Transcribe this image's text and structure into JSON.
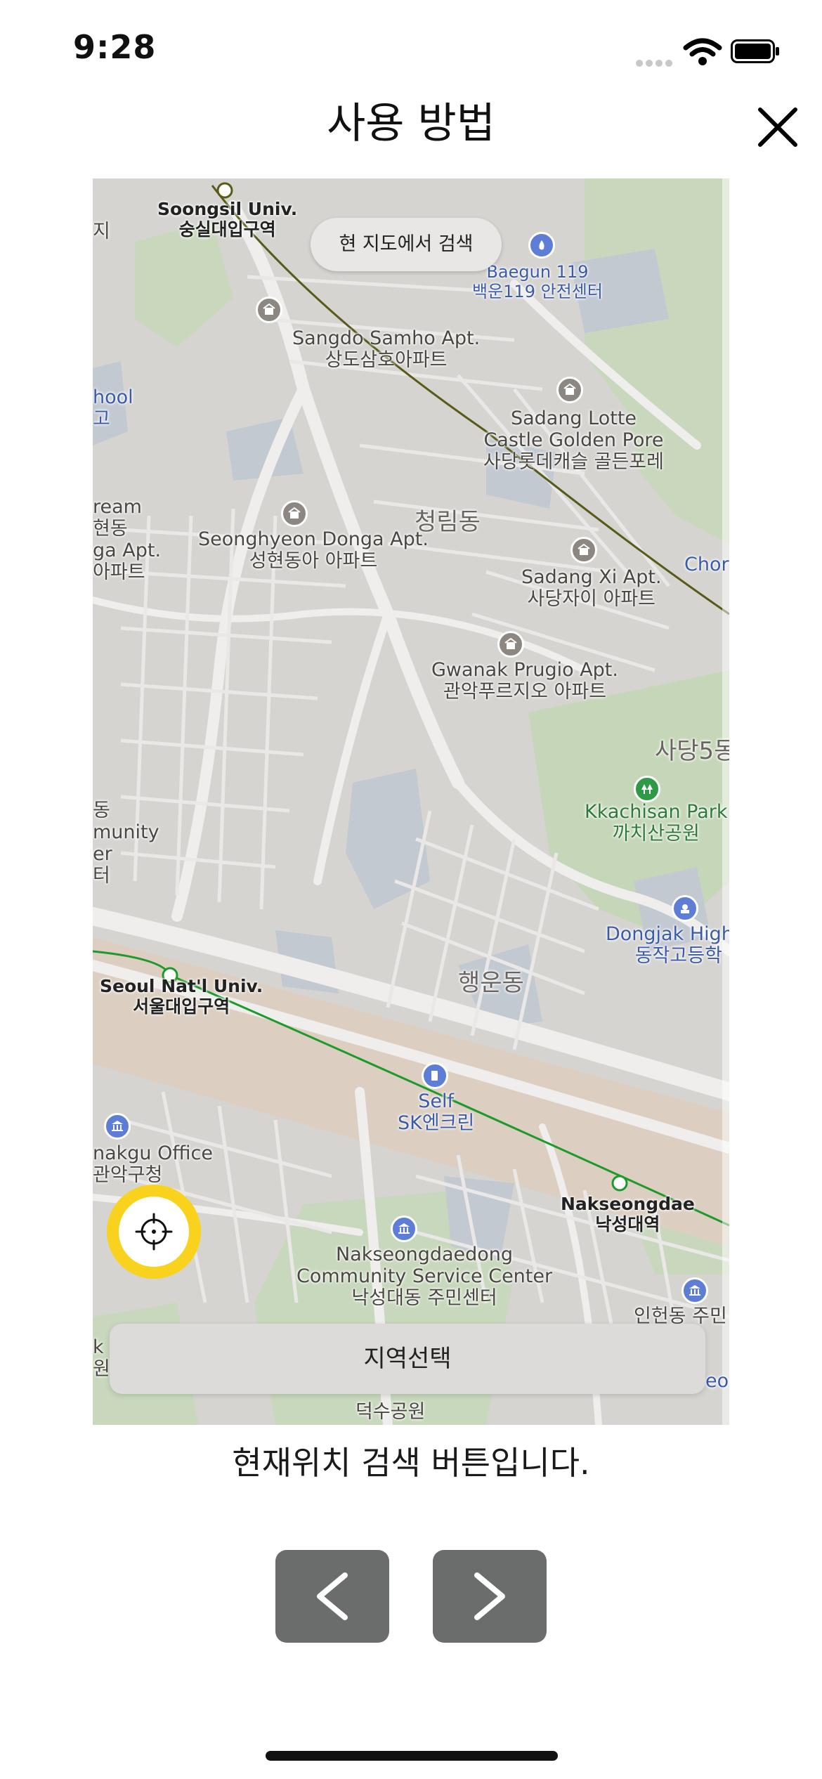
{
  "status_bar": {
    "time": "9:28"
  },
  "header": {
    "title": "사용 방법"
  },
  "map": {
    "search_here_label": "현 지도에서 검색",
    "region_select_label": "지역선택",
    "labels": {
      "soongsil": "Soongsil Univ.\n숭실대입구역",
      "baegun": "Baegun 119\n백운119 안전센터",
      "sangdo": "Sangdo Samho Apt.\n상도삼호아파트",
      "sadang_lotte": "Sadang Lotte\nCastle Golden Pore\n사당롯데캐슬 골든포레",
      "cheongrim": "청림동",
      "seonghyeon": "Seonghyeon Donga Apt.\n성현동아 아파트",
      "sadang_xi": "Sadang Xi Apt.\n사당자이 아파트",
      "gwanak_prugio": "Gwanak Prugio Apt.\n관악푸르지오 아파트",
      "sadang5": "사당5동",
      "kkachisan": "Kkachisan Park\n까치산공원",
      "dongjak_high": "Dongjak High S\n동작고등학",
      "haengun": "행운동",
      "seoul_nat": "Seoul Nat'l Univ.\n서울대입구역",
      "self_sk": "Self\nSK엔크린",
      "gwanakgu_office": "nakgu Office\n관악구청",
      "nakseongdae": "Nakseongdae\n낙성대역",
      "nakseongdaedong": "Nakseongdaedong\nCommunity Service Center\n낙성대동 주민센터",
      "inheon": "인헌동 주민",
      "deoksu": "덕수공원",
      "school_left": "hool\n고",
      "cream_left": "ream\n현동\nga Apt.\n아파트",
      "community_left": "동\nmunity\ner\n터",
      "chor_right": "Chor",
      "jiji_left": "지",
      "kp_left": "k P\n원",
      "eo_right": "eo"
    }
  },
  "caption": "현재위치 검색 버튼입니다.",
  "nav": {
    "prev_icon": "chevron-left-icon",
    "next_icon": "chevron-right-icon"
  },
  "colors": {
    "accent_yellow": "#f8d21c",
    "nav_button": "#6b6d6c",
    "subway_green": "#1c9a2a",
    "subway_olive": "#5a5a18"
  }
}
